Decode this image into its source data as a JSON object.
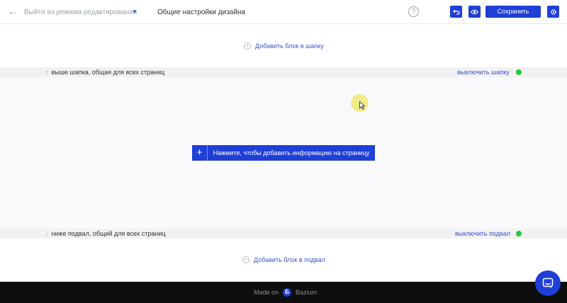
{
  "topbar": {
    "exit_label": "Выйти из режима редактирования",
    "settings_title": "Общие настройки дизайна",
    "help_symbol": "?",
    "save_label": "Сохранить"
  },
  "header_area": {
    "add_block_label": "Добавить блок в шапку"
  },
  "band_top": {
    "note": "выше шапка, общая для всех страниц",
    "toggle_label": "выключить шапку",
    "status_color": "#27c93f"
  },
  "main": {
    "add_info_label": "Нажмите, чтобы добавить информацию на страницу"
  },
  "band_bottom": {
    "note": "ниже подвал, общий для всех страниц",
    "toggle_label": "выключить подвал",
    "status_color": "#27c93f"
  },
  "footer_area": {
    "add_block_label": "Добавить блок в подвал"
  },
  "footer": {
    "made_on": "Made on",
    "logo_letter": "Б",
    "brand": "Bazium"
  },
  "colors": {
    "accent": "#1f3fd6",
    "link": "#3a57c9",
    "footer_bg": "#0e0e0e"
  }
}
